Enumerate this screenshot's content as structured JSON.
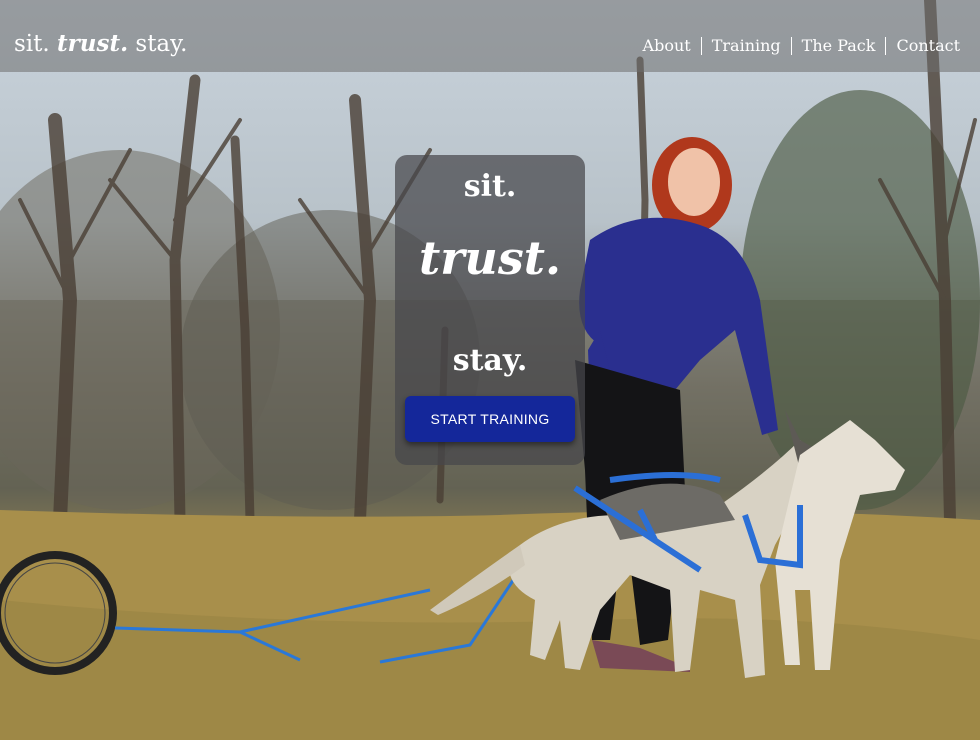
{
  "header": {
    "logo": {
      "part1": "sit.",
      "part2": "trust.",
      "part3": "stay."
    },
    "nav": [
      "About",
      "Training",
      "The Pack",
      "Contact"
    ]
  },
  "hero": {
    "line1": "sit.",
    "line2": "trust.",
    "line3": "stay.",
    "button_label": "START TRAINING"
  },
  "background": {
    "icon": "photo-woman-with-two-huskies-on-grass",
    "colors": {
      "sky": "#c9d3dc",
      "grass": "#b09a58",
      "jacket": "#2a2f8f",
      "harness": "#2b6fd6"
    }
  },
  "colors": {
    "header_bg": "rgba(110,110,110,0.55)",
    "card_bg": "rgba(70,70,75,0.72)",
    "button": "#14279a",
    "text": "#ffffff"
  }
}
